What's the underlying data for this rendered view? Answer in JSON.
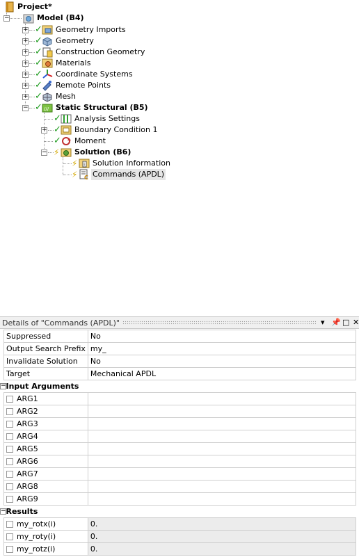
{
  "tree": {
    "project": "Project*",
    "model": "Model (B4)",
    "geometry_imports": "Geometry Imports",
    "geometry": "Geometry",
    "construction_geometry": "Construction Geometry",
    "materials": "Materials",
    "coordinate_systems": "Coordinate Systems",
    "remote_points": "Remote Points",
    "mesh": "Mesh",
    "static_structural": "Static Structural (B5)",
    "analysis_settings": "Analysis Settings",
    "boundary_condition": "Boundary Condition 1",
    "moment": "Moment",
    "solution": "Solution (B6)",
    "solution_information": "Solution Information",
    "commands": "Commands (APDL)"
  },
  "details": {
    "title": "Details of \"Commands (APDL)\"",
    "pin": "▾ ⌂ □ ✕",
    "rows": [
      {
        "key": "Suppressed",
        "value": "No"
      },
      {
        "key": "Output Search Prefix",
        "value": "my_"
      },
      {
        "key": "Invalidate Solution",
        "value": "No"
      },
      {
        "key": "Target",
        "value": "Mechanical APDL"
      }
    ],
    "input_group": "Input Arguments",
    "args": [
      "ARG1",
      "ARG2",
      "ARG3",
      "ARG4",
      "ARG5",
      "ARG6",
      "ARG7",
      "ARG8",
      "ARG9"
    ],
    "results_group": "Results",
    "results": [
      {
        "key": "my_rotx(i)",
        "value": "0."
      },
      {
        "key": "my_roty(i)",
        "value": "0."
      },
      {
        "key": "my_rotz(i)",
        "value": "0."
      }
    ]
  }
}
